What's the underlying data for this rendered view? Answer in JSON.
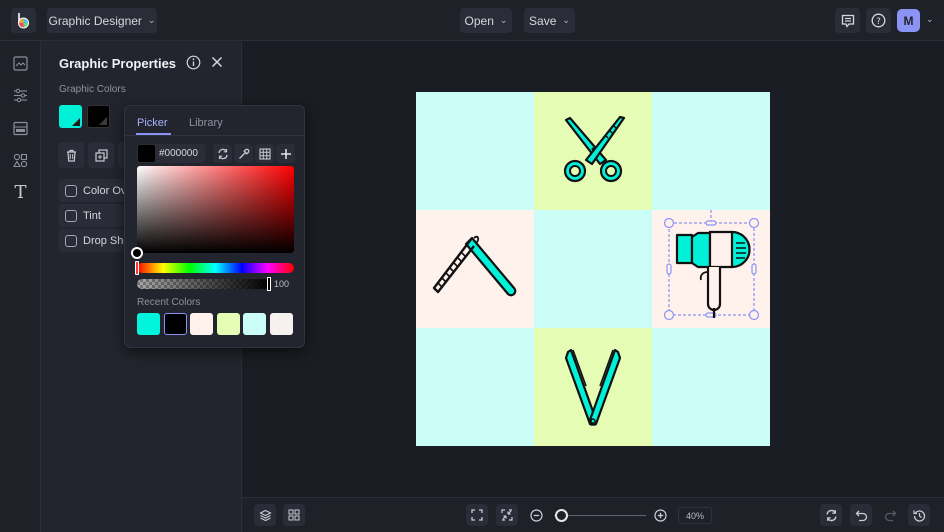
{
  "topbar": {
    "app_menu_label": "Graphic Designer",
    "open_label": "Open",
    "save_label": "Save",
    "avatar_initial": "M",
    "avatar_color": "#8b93f5"
  },
  "left_rail": {
    "items": [
      "image-icon",
      "adjustments-icon",
      "layout-icon",
      "shapes-icon",
      "text-icon"
    ]
  },
  "panel": {
    "title": "Graphic Properties",
    "section_label": "Graphic Colors",
    "colors": [
      "#00f0d8",
      "#000000"
    ],
    "options": [
      {
        "label": "Color Overlay",
        "visible_label": "Color Ov",
        "checked": false
      },
      {
        "label": "Tint",
        "visible_label": "Tint",
        "checked": false
      },
      {
        "label": "Drop Shadow",
        "visible_label": "Drop Sho",
        "checked": false
      }
    ]
  },
  "color_picker": {
    "tabs": [
      {
        "label": "Picker",
        "active": true
      },
      {
        "label": "Library",
        "active": false
      }
    ],
    "hex_value": "#000000",
    "hue": "#ff0000",
    "opacity_value": "100",
    "recent_label": "Recent Colors",
    "recent_colors": [
      "#00f5dc",
      "#000000",
      "#fff1ec",
      "#e5fcb5",
      "#c9fdf6",
      "#f6f0ef"
    ],
    "selected_recent_index": 1
  },
  "canvas": {
    "cells": [
      {
        "bg": "#c9fdf6",
        "icon": ""
      },
      {
        "bg": "#e5fcb5",
        "icon": "scissors"
      },
      {
        "bg": "#c9fdf6",
        "icon": ""
      },
      {
        "bg": "#fff1ec",
        "icon": "straight-razor"
      },
      {
        "bg": "#c9fdf6",
        "icon": ""
      },
      {
        "bg": "#fff1ec",
        "icon": "hair-dryer"
      },
      {
        "bg": "#c9fdf6",
        "icon": ""
      },
      {
        "bg": "#e5fcb5",
        "icon": "hair-straightener"
      },
      {
        "bg": "#c9fdf6",
        "icon": ""
      }
    ],
    "accent_fill": "#00f0d8",
    "selected_icon": "hair-dryer"
  },
  "bottombar": {
    "zoom_level": "40%",
    "zoom_fraction": 0.0
  }
}
